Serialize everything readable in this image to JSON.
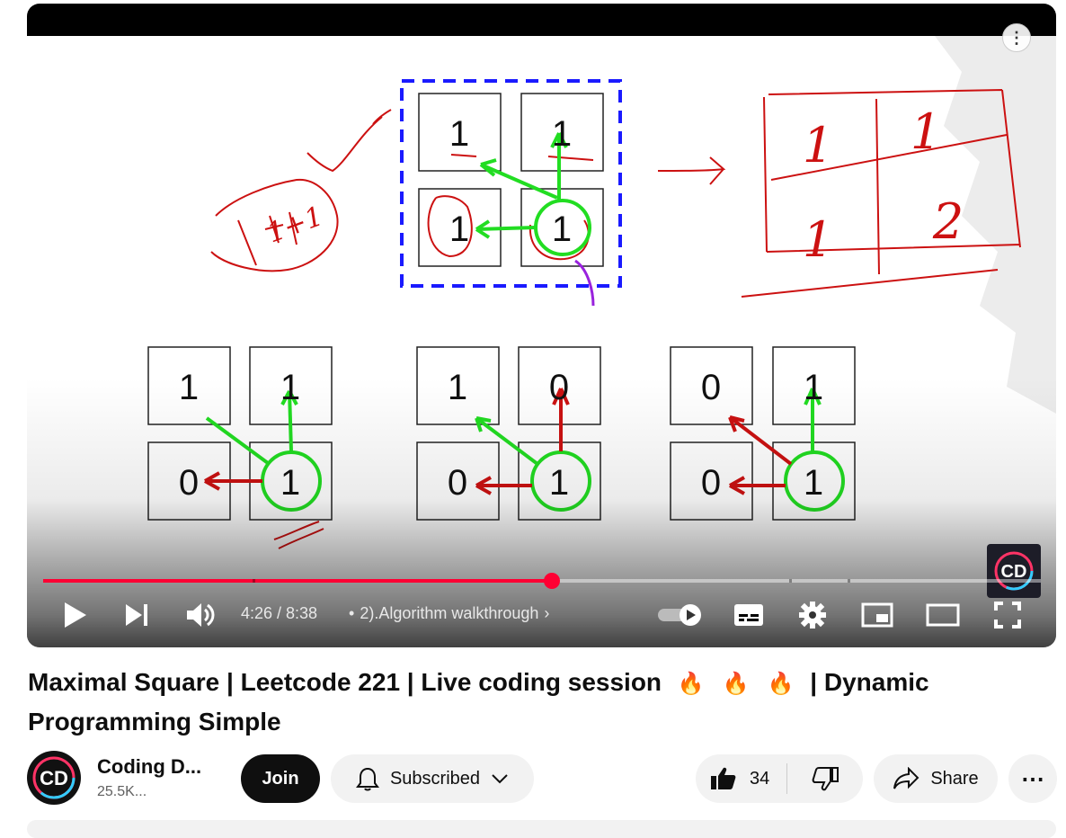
{
  "player": {
    "time": "4:26 / 8:38",
    "chapter": "2).Algorithm walkthrough",
    "progress_fraction": 0.51
  },
  "slide": {
    "top_grid": [
      "1",
      "1",
      "1",
      "1"
    ],
    "drawn_table": [
      "1",
      "1",
      "1",
      "2"
    ],
    "drawn_note": "1+1",
    "bottom_grids": [
      [
        "1",
        "1",
        "0",
        "1"
      ],
      [
        "1",
        "0",
        "0",
        "1"
      ],
      [
        "0",
        "1",
        "0",
        "1"
      ]
    ],
    "watermark": "CD"
  },
  "video": {
    "title_part1": "Maximal Square | Leetcode 221 | Live coding session",
    "title_part2": "| Dynamic Programming Simple"
  },
  "channel": {
    "name": "Coding D...",
    "subscribers": "25.5K...",
    "avatar_text": "CD"
  },
  "actions": {
    "join": "Join",
    "subscribed": "Subscribed",
    "likes": "34",
    "share": "Share"
  },
  "colors": {
    "progress_red": "#ff0033",
    "accent_dark": "#0f0f0f"
  }
}
